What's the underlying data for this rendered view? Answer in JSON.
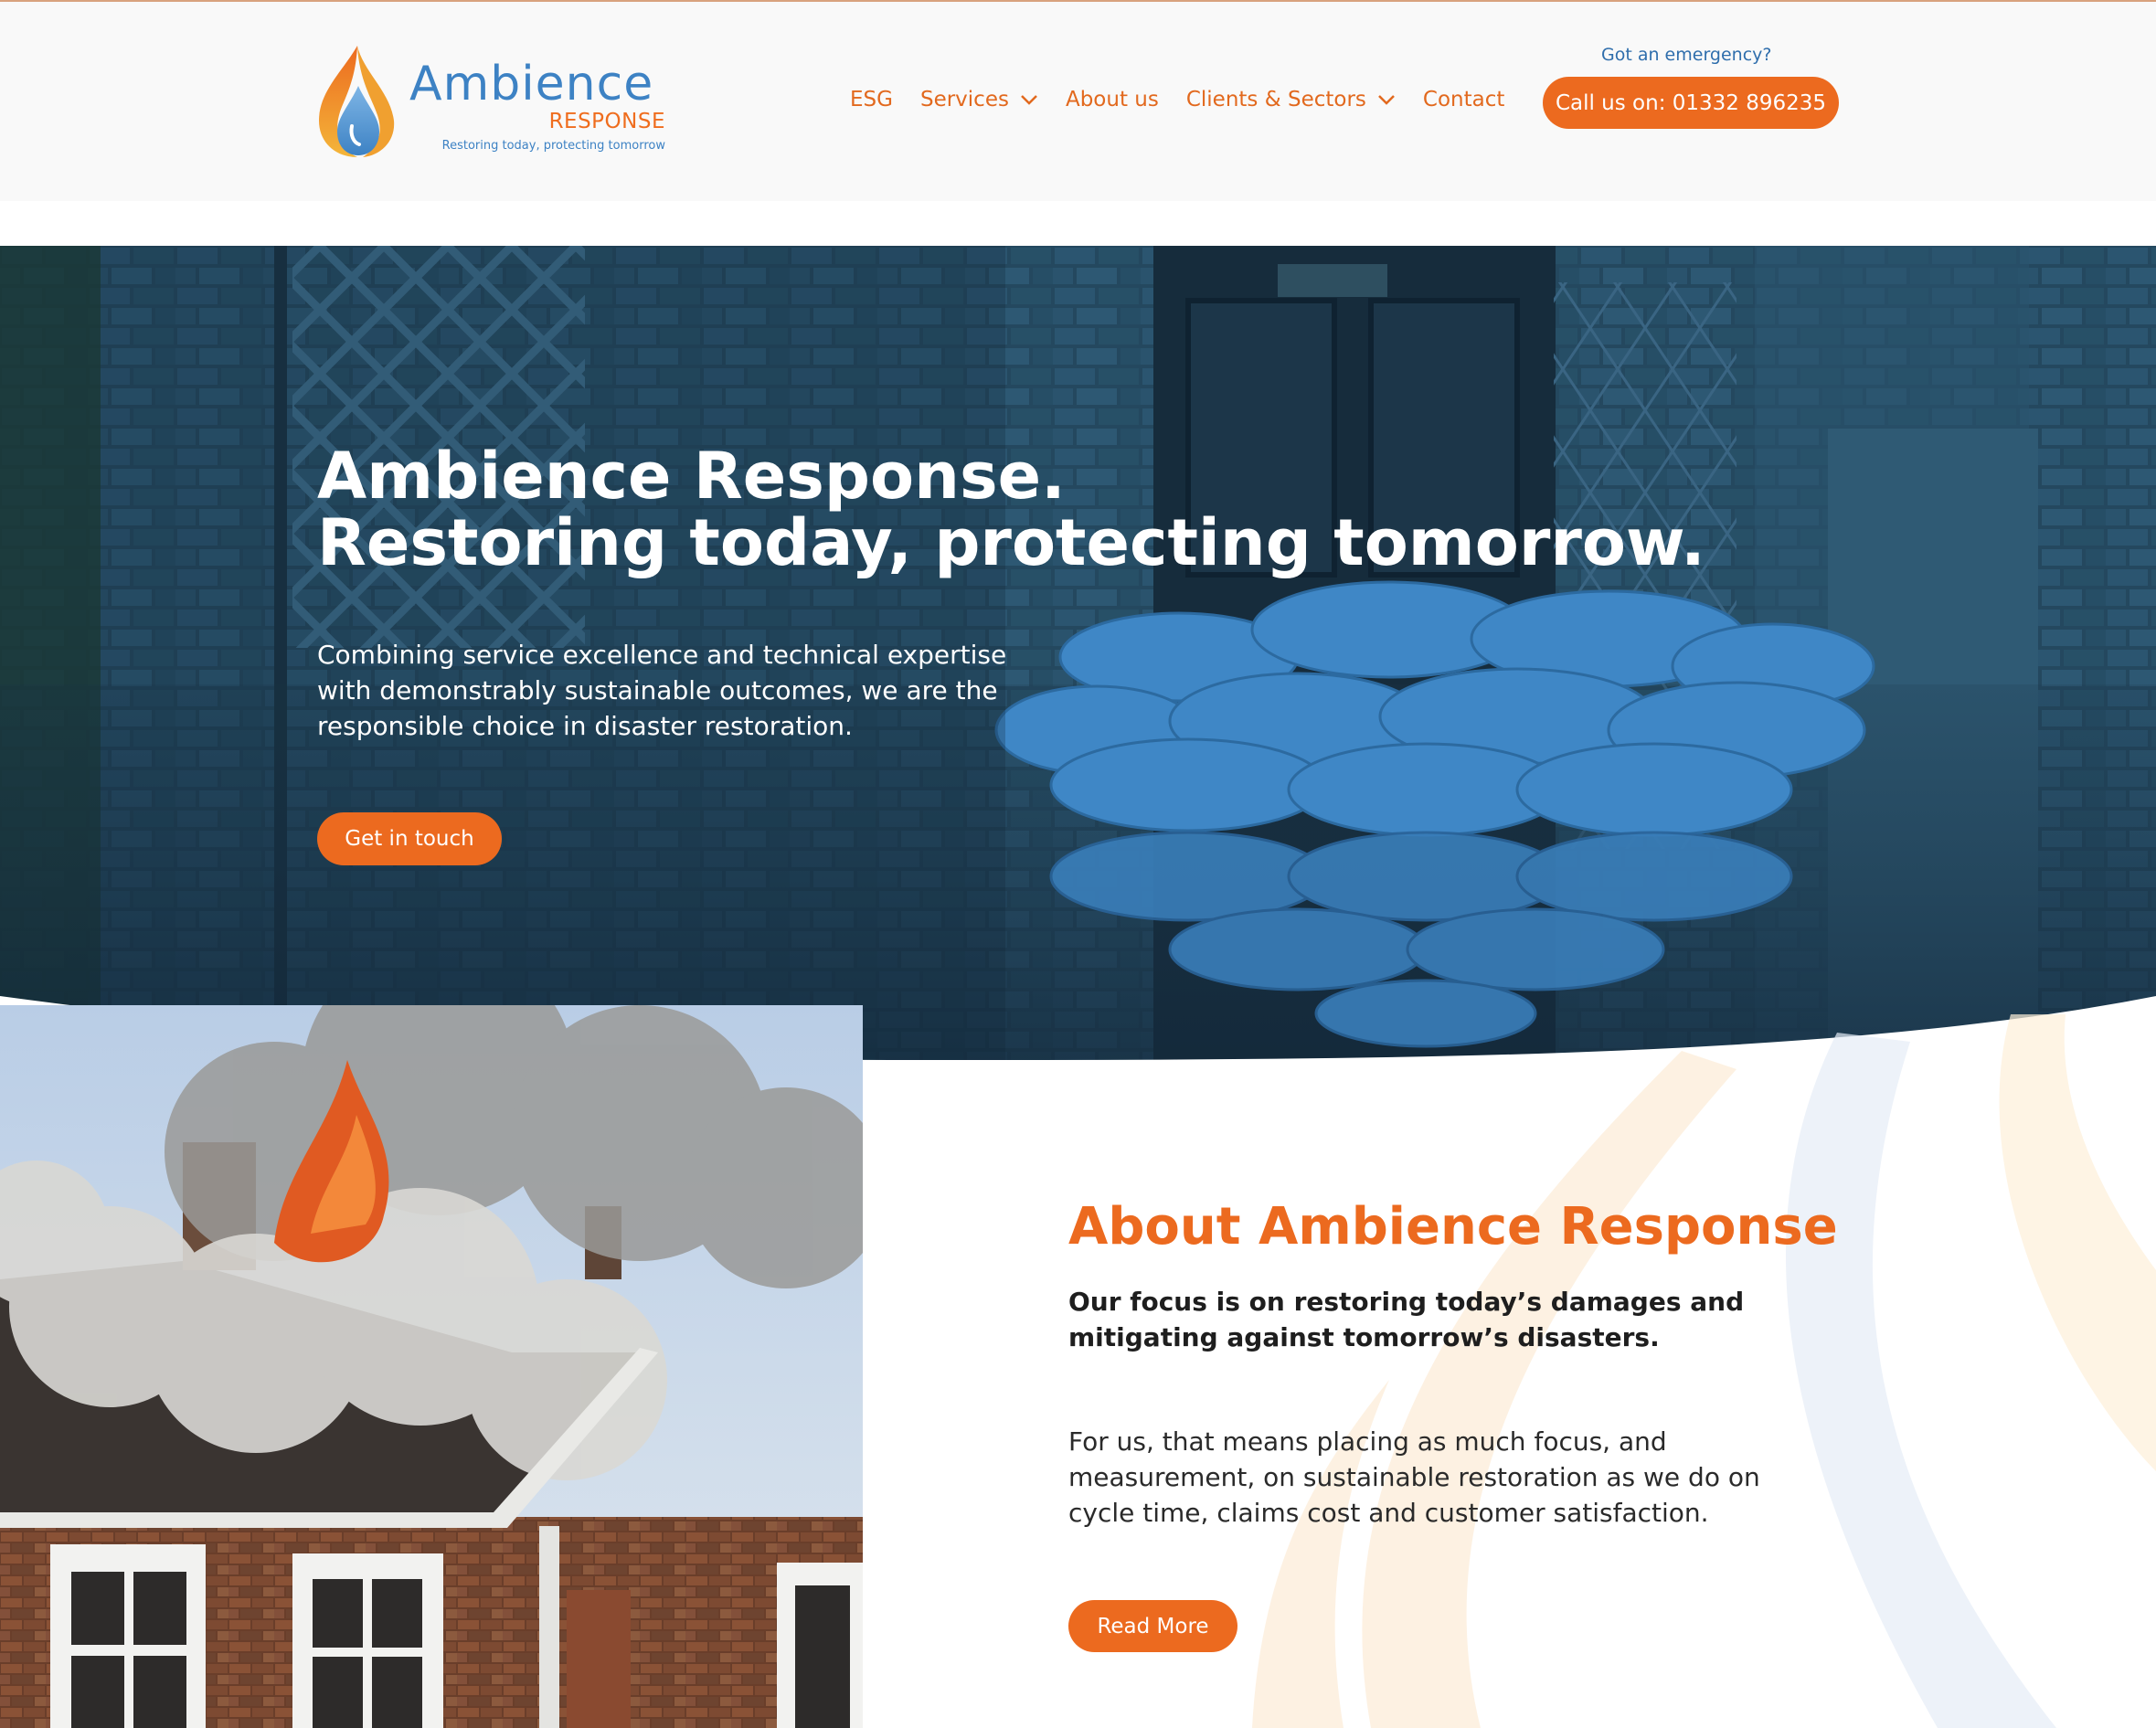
{
  "header": {
    "logo": {
      "name": "Ambience",
      "sub": "RESPONSE",
      "tagline": "Restoring today, protecting tomorrow"
    },
    "nav": [
      {
        "label": "ESG",
        "has_dropdown": false
      },
      {
        "label": "Services",
        "has_dropdown": true
      },
      {
        "label": "About us",
        "has_dropdown": false
      },
      {
        "label": "Clients & Sectors",
        "has_dropdown": true
      },
      {
        "label": "Contact",
        "has_dropdown": false
      }
    ],
    "emergency_label": "Got an emergency?",
    "call_button": "Call us on: 01332 896235"
  },
  "hero": {
    "title_line1": "Ambience Response.",
    "title_line2": "Restoring today, protecting tomorrow.",
    "text": "Combining service excellence and technical expertise with demonstrably sustainable outcomes, we are the responsible choice in disaster restoration.",
    "button": "Get in touch"
  },
  "about": {
    "title": "About Ambience Response",
    "lead": "Our focus is on restoring today’s damages and mitigating against tomorrow’s disasters.",
    "body": "For us, that means placing as much focus, and measurement, on sustainable restoration as we do on cycle time, claims cost and customer satisfaction.",
    "button": "Read More"
  },
  "colors": {
    "brand_orange": "#ec6a1f",
    "brand_blue": "#3d82c4",
    "hero_overlay": "#203f56"
  },
  "icons": {
    "dropdown": "chevron-down-icon",
    "logo": "flame-droplet-logo-icon"
  }
}
